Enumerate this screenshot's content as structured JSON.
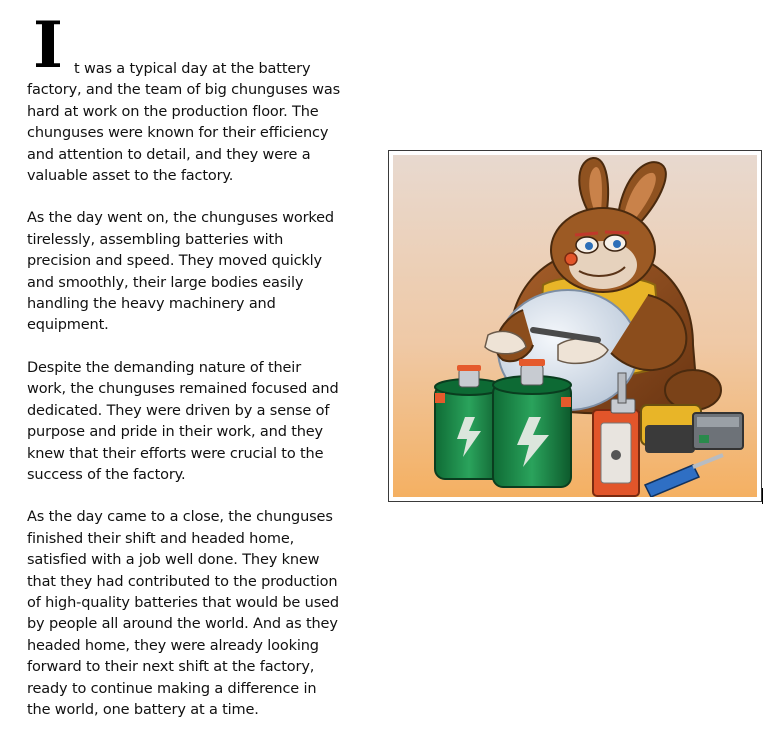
{
  "article": {
    "drop_cap": "I",
    "paragraph_1_rest": "t was a typical day at the battery factory, and the team of big chunguses was hard at work on the production floor. The chunguses were known for their efficiency and attention to detail, and they were a valuable asset to the factory.",
    "paragraph_2": "As the day went on, the chunguses worked tirelessly, assembling batteries with precision and speed. They moved quickly and smoothly, their large bodies easily handling the heavy machinery and equipment.",
    "paragraph_3": "Despite the demanding nature of their work, the chunguses remained focused and dedicated. They were driven by a sense of purpose and pride in their work, and they knew that their efforts were crucial to the success of the factory.",
    "paragraph_4": "As the day came to a close, the chunguses finished their shift and headed home, satisfied with a job well done. They knew that they had contributed to the production of high-quality batteries that would be used by people all around the world. And as they headed home, they were already looking forward to their next shift at the factory, ready to continue making a difference in the world, one battery at a time."
  },
  "colors": {
    "text": "#111111",
    "frame_border": "#3a3a3a",
    "illustration_bg_top": "#e8d8cc",
    "illustration_bg_bottom": "#f3b468",
    "rabbit_fur": "#8a4d1e",
    "shirt": "#e8b528",
    "battery_green": "#1f8a4c"
  }
}
